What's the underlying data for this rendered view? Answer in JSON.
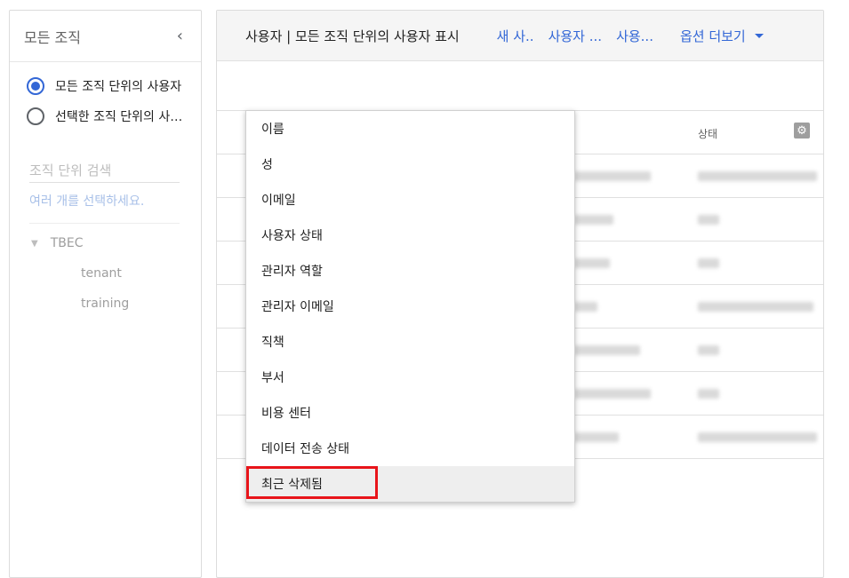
{
  "left_panel": {
    "title": "모든 조직",
    "collapse_icon": "chevron-left-icon",
    "radio_options": [
      {
        "label": "모든 조직 단위의 사용자",
        "checked": true
      },
      {
        "label": "선택한 조직 단위의 사…",
        "checked": false
      }
    ],
    "search_placeholder": "조직 단위 검색",
    "select_hint": "여러 개를 선택하세요.",
    "tree": {
      "root": "TBEC",
      "children": [
        "tenant",
        "training"
      ]
    }
  },
  "toolbar": {
    "title": "사용자 | 모든 조직 단위의 사용자 표시",
    "links": [
      "새 사..",
      "사용자 ...",
      "사용..."
    ],
    "more_label": "옵션 더보기"
  },
  "table": {
    "status_header": "상태",
    "settings_icon": "gear-icon",
    "rows": 7
  },
  "dropdown": {
    "items": [
      "이름",
      "성",
      "이메일",
      "사용자 상태",
      "관리자 역할",
      "관리자 이메일",
      "직책",
      "부서",
      "비용 센터",
      "데이터 전송 상태",
      "최근 삭제됨"
    ],
    "hovered_index": 10
  },
  "colors": {
    "accent": "#3367d6",
    "highlight": "#e8141a"
  }
}
